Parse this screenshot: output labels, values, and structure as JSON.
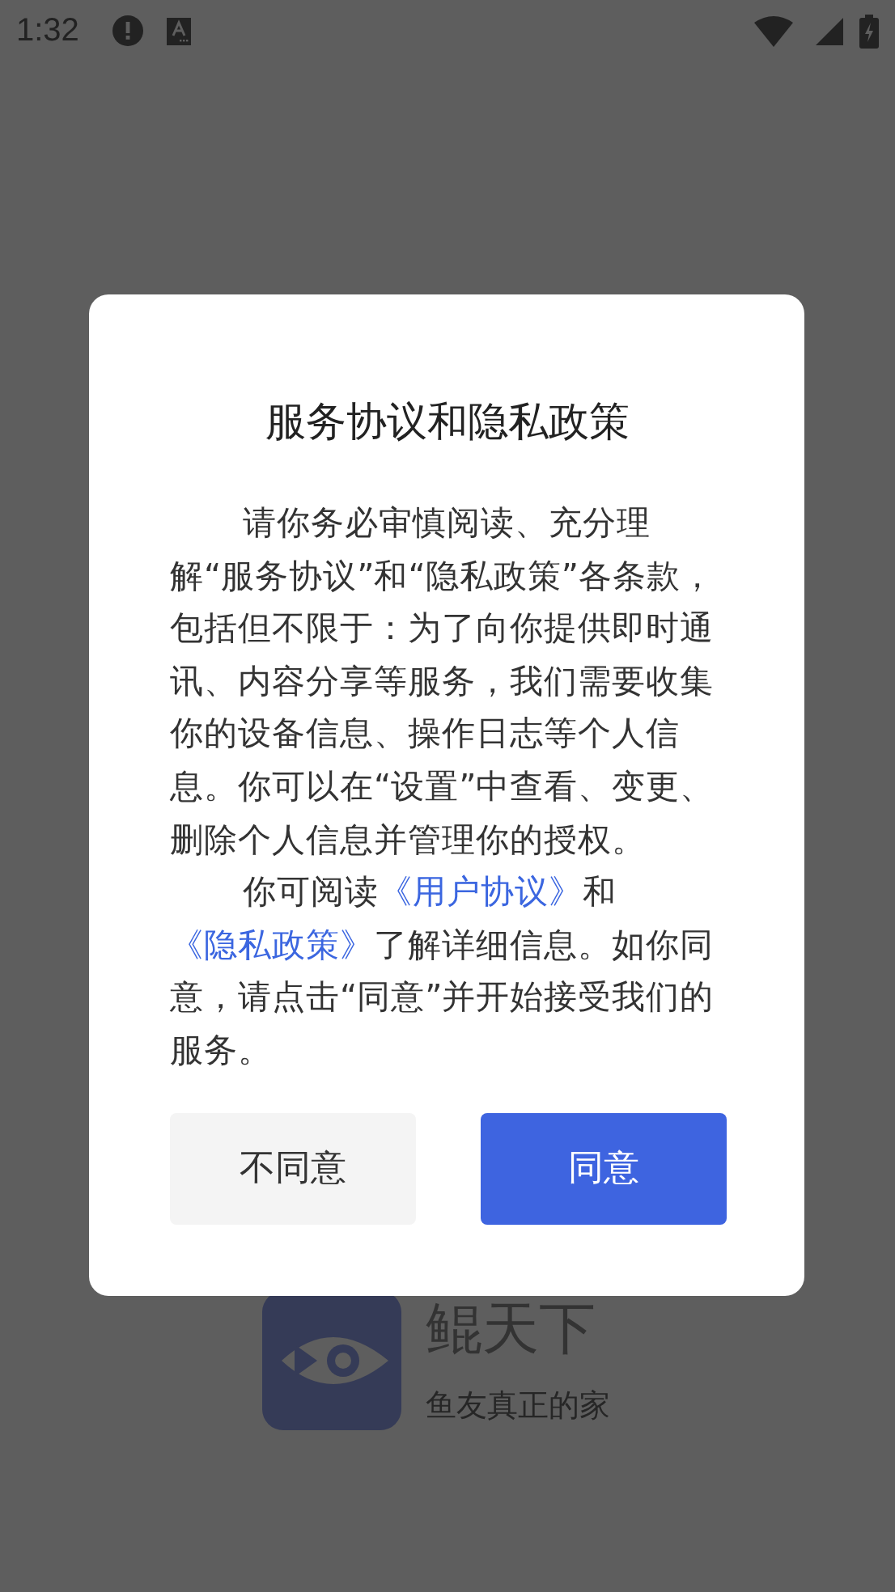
{
  "status_bar": {
    "time": "1:32"
  },
  "app": {
    "name": "鲲天下",
    "slogan": "鱼友真正的家"
  },
  "dialog": {
    "title": "服务协议和隐私政策",
    "paragraphs": [
      [
        {
          "kind": "text",
          "text": "请你务必审慎阅读、充分理解“服务协议”和“隐私政策”各条款，包括但不限于：为了向你提供即时通讯、内容分享等服务，我们需要收集你的设备信息、操作日志等个人信息。你可以在“设置”中查看、变更、删除个人信息并管理你的授权。"
        }
      ],
      [
        {
          "kind": "text",
          "text": "你可阅读"
        },
        {
          "kind": "link",
          "text": "《用户协议》"
        },
        {
          "kind": "text",
          "text": "和"
        },
        {
          "kind": "link",
          "text": "《隐私政策》"
        },
        {
          "kind": "text",
          "text": "了解详细信息。如你同意，请点击“同意”并开始接受我们的服务。"
        }
      ]
    ],
    "buttons": [
      {
        "kind": "secondary",
        "label": "不同意"
      },
      {
        "kind": "primary",
        "label": "同意"
      }
    ]
  }
}
